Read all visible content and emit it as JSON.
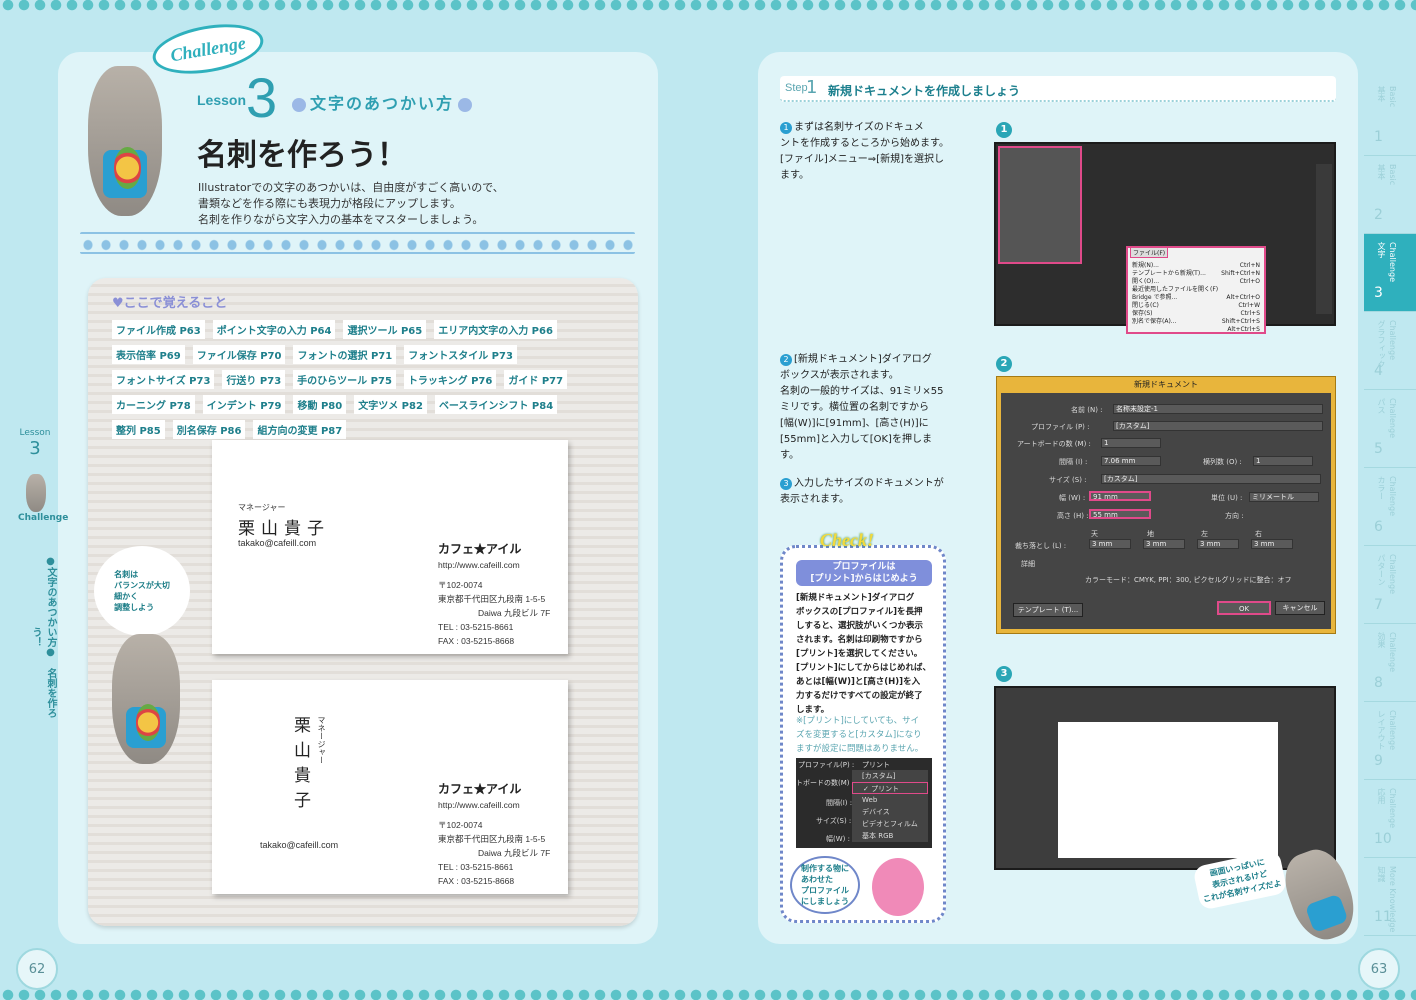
{
  "left": {
    "challenge": "Challenge",
    "lesson_label": "Lesson",
    "lesson_number": "3",
    "lesson_subtitle": "文字のあつかい方",
    "title": "名刺を作ろう！",
    "intro": [
      "Illustratorでの文字のあつかいは、自由度がすごく高いので、",
      "書類などを作る際にも表現力が格段にアップします。",
      "名刺を作りながら文字入力の基本をマスターしましょう。"
    ],
    "panel_head": "♥ここで覚えること",
    "tags": [
      "ファイル作成 P63",
      "ポイント文字の入力 P64",
      "選択ツール P65",
      "エリア内文字の入力 P66",
      "表示倍率 P69",
      "ファイル保存 P70",
      "フォントの選択 P71",
      "フォントスタイル P73",
      "フォントサイズ P73",
      "行送り P73",
      "手のひらツール P75",
      "トラッキング P76",
      "ガイド P77",
      "カーニング P78",
      "インデント P79",
      "移動 P80",
      "文字ツメ P82",
      "ベースラインシフト P84",
      "整列 P85",
      "別名保存 P86",
      "組方向の変更 P87"
    ],
    "bubble": [
      "名刺は",
      "バランスが大切",
      "細かく",
      "調整しよう"
    ],
    "card": {
      "role": "マネージャー",
      "name": "栗山貴子",
      "email": "takako@cafeill.com",
      "company": "カフェ★アイル",
      "url": "http://www.cafeill.com",
      "zip": "〒102-0074",
      "address1": "東京都千代田区九段南 1-5-5",
      "address2": "Daiwa 九段ビル 7F",
      "tel": "TEL : 03-5215-8661",
      "fax": "FAX : 03-5215-8668"
    },
    "side_tab": {
      "lesson": "Lesson",
      "num": "3",
      "challenge": "Challenge",
      "vertical": "●文字のあつかい方●　名刺を作ろう！"
    },
    "page_number": "62"
  },
  "right": {
    "step_label": "Step",
    "step_num": "1",
    "step_title": "新規ドキュメントを作成しましょう",
    "p1": [
      "まずは名刺サイズのドキュメ",
      "ントを作成するところから始めます。",
      "[ファイル]メニュー⇒[新規]を選択し",
      "ます。"
    ],
    "p2": [
      "[新規ドキュメント]ダイアログ",
      "ボックスが表示されます。",
      "名刺の一般的サイズは、91ミリ×55",
      "ミリです。横位置の名刺ですから",
      "[幅(W)]に[91mm]、[高さ(H)]に",
      "[55mm]と入力して[OK]を押しま",
      "す。"
    ],
    "p3": [
      "入力したサイズのドキュメントが",
      "表示されます。"
    ],
    "check": {
      "title": "Check!",
      "head": [
        "プロファイルは",
        "[プリント]からはじめよう"
      ],
      "body": [
        "[新規ドキュメント]ダイアログ",
        "ボックスの[プロファイル]を長押",
        "しすると、選択肢がいくつか表示",
        "されます。名刺は印刷物ですから",
        "[プリント]を選択してください。",
        "[プリント]にしてからはじめれば、",
        "あとは[幅(W)]と[高さ(H)]を入",
        "力するだけですべての設定が終了",
        "します。"
      ],
      "note": [
        "※[プリント]にしていても、サイ",
        "ズを変更すると[カスタム]になり",
        "ますが設定に問題はありません。"
      ],
      "menu": {
        "profile": "プロファイル(P) :",
        "current": "プリント",
        "items": [
          "[カスタム]",
          "✓ プリント",
          "Web",
          "デバイス",
          "ビデオとフィルム",
          "基本 RGB"
        ],
        "labels": [
          "トボードの数(M) :",
          "間隔(I) :",
          "サイズ(S) :",
          "幅(W) :"
        ]
      },
      "bubble": [
        "制作する物に",
        "あわせた",
        "プロファイル",
        "にしましょう"
      ]
    },
    "menu": {
      "head": "ファイル(F)",
      "items": [
        [
          "新規(N)...",
          "Ctrl+N"
        ],
        [
          "テンプレートから新規(T)...",
          "Shift+Ctrl+N"
        ],
        [
          "開く(O)...",
          "Ctrl+O"
        ],
        [
          "最近使用したファイルを開く(F)",
          ""
        ],
        [
          "Bridge で参照...",
          "Alt+Ctrl+O"
        ],
        [
          "閉じる(C)",
          "Ctrl+W"
        ],
        [
          "保存(S)",
          "Ctrl+S"
        ],
        [
          "別名で保存(A)...",
          "Shift+Ctrl+S"
        ],
        [
          "",
          "Alt+Ctrl+S"
        ]
      ]
    },
    "dialog": {
      "title": "新規ドキュメント",
      "name_label": "名前 (N) :",
      "name_val": "名称未設定-1",
      "profile_label": "プロファイル (P) :",
      "profile_val": "[カスタム]",
      "artboards_label": "アートボードの数 (M) :",
      "artboards_val": "1",
      "spacing_label": "間隔 (I) :",
      "spacing_val": "7.06 mm",
      "cols_label": "横列数 (O) :",
      "cols_val": "1",
      "size_label": "サイズ (S) :",
      "size_val": "[カスタム]",
      "width_label": "幅 (W) :",
      "width_val": "91 mm",
      "height_label": "高さ (H) :",
      "height_val": "55 mm",
      "unit_label": "単位 (U) :",
      "unit_val": "ミリメートル",
      "orient_label": "方向 :",
      "bleed_label": "裁ち落とし (L) :",
      "bleed_cols": [
        "天",
        "地",
        "左",
        "右"
      ],
      "bleed_val": "3 mm",
      "detail": "詳細",
      "color_info": "カラーモード：CMYK, PPI：300, ピクセルグリッドに整合：オフ",
      "template_btn": "テンプレート (T)...",
      "ok_btn": "OK",
      "cancel_btn": "キャンセル"
    },
    "mascot_bubble": [
      "画面いっぱいに",
      "表示されるけど",
      "これが名刺サイズだよ"
    ],
    "tabs": [
      {
        "name": "基本",
        "n": "1",
        "en": "Basic"
      },
      {
        "name": "基本",
        "n": "2",
        "en": "Basic"
      },
      {
        "name": "文字",
        "n": "3",
        "en": "Challenge",
        "active": true
      },
      {
        "name": "グラフィック",
        "n": "4",
        "en": "Challenge"
      },
      {
        "name": "パス",
        "n": "5",
        "en": "Challenge"
      },
      {
        "name": "カラー",
        "n": "6",
        "en": "Challenge"
      },
      {
        "name": "パターン",
        "n": "7",
        "en": "Challenge"
      },
      {
        "name": "効果",
        "n": "8",
        "en": "Challenge"
      },
      {
        "name": "レイアウト",
        "n": "9",
        "en": "Challenge"
      },
      {
        "name": "応用",
        "n": "10",
        "en": "Challenge"
      },
      {
        "name": "知識",
        "n": "11",
        "en": "More Knowledge"
      }
    ],
    "page_number": "63"
  }
}
